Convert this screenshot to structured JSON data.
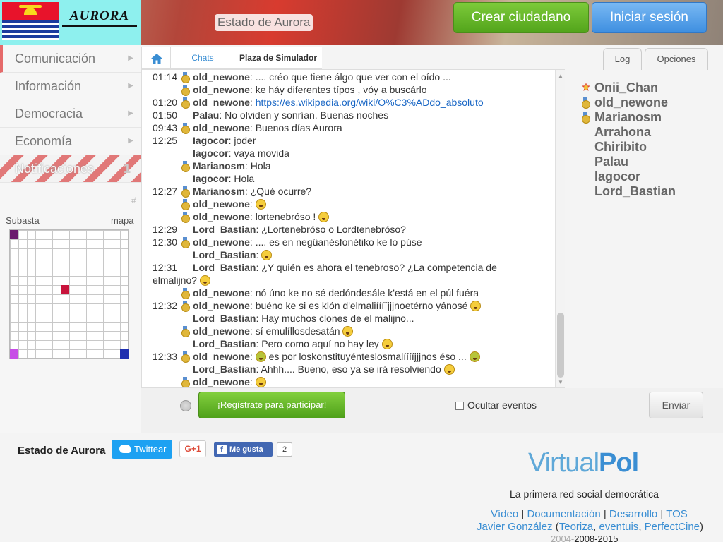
{
  "header": {
    "logo_text": "AURORA",
    "site_name": "Estado de Aurora",
    "create_citizen": "Crear ciudadano",
    "login": "Iniciar sesión"
  },
  "sidebar": {
    "items": [
      {
        "label": "Comunicación"
      },
      {
        "label": "Información"
      },
      {
        "label": "Democracia"
      },
      {
        "label": "Economía"
      },
      {
        "label": "Notificaciones",
        "count": "1"
      }
    ],
    "hash": "#",
    "auction": "Subasta",
    "map": "mapa"
  },
  "breadcrumb": {
    "chats": "Chats",
    "current": "Plaza de Simulador"
  },
  "tabs": {
    "log": "Log",
    "options": "Opciones"
  },
  "chat": {
    "messages": [
      {
        "time": "01:14",
        "nick": "old_newone",
        "text": ".... créo que tiene álgo que ver con el oído ...",
        "medal": true
      },
      {
        "time": "",
        "nick": "old_newone",
        "text": "ke háy diferentes típos , vóy a buscárlo",
        "medal": true
      },
      {
        "time": "01:20",
        "nick": "old_newone",
        "link": "https://es.wikipedia.org/wiki/O%C3%ADdo_absoluto",
        "medal": true
      },
      {
        "time": "01:50",
        "nick": "Palau",
        "text": "No olviden y sonrían. Buenas noches",
        "medal": false
      },
      {
        "time": "09:43",
        "nick": "old_newone",
        "text": "Buenos días Aurora",
        "medal": true
      },
      {
        "time": "12:25",
        "nick": "Iagocor",
        "text": "joder",
        "medal": false
      },
      {
        "time": "",
        "nick": "Iagocor",
        "text": "vaya movida",
        "medal": false
      },
      {
        "time": "",
        "nick": "Marianosm",
        "text": "Hola",
        "medal": true
      },
      {
        "time": "",
        "nick": "Iagocor",
        "text": "Hola",
        "medal": false
      },
      {
        "time": "12:27",
        "nick": "Marianosm",
        "text": "¿Qué ocurre?",
        "medal": true
      },
      {
        "time": "",
        "nick": "old_newone",
        "text": "",
        "medal": true,
        "emoji": true
      },
      {
        "time": "",
        "nick": "old_newone",
        "text": "lortenebróso !",
        "medal": true,
        "emoji": true
      },
      {
        "time": "12:29",
        "nick": "Lord_Bastian",
        "text": "¿Lortenebróso o Lordtenebróso?",
        "medal": false
      },
      {
        "time": "12:30",
        "nick": "old_newone",
        "text": ".... es en negüanésfonétiko ke lo púse",
        "medal": true
      },
      {
        "time": "",
        "nick": "Lord_Bastian",
        "text": "",
        "medal": false,
        "emoji": true
      },
      {
        "time": "12:31",
        "nick": "Lord_Bastian",
        "text": "¿Y quién es ahora el tenebroso? ¿La competencia de",
        "medal": false
      },
      {
        "time": "",
        "nick": "",
        "text": "elmalijno?",
        "medal": false,
        "emoji": true,
        "continuation": true
      },
      {
        "time": "",
        "nick": "old_newone",
        "text": "nó úno ke no sé dedóndesále k'está en el púl fuéra",
        "medal": true
      },
      {
        "time": "12:32",
        "nick": "old_newone",
        "text": "buéno ke si es klón d'elmaliííí¨jjjnoetérno yánosé",
        "medal": true,
        "emoji": true
      },
      {
        "time": "",
        "nick": "Lord_Bastian",
        "text": "Hay muchos clones de el malijno...",
        "medal": false
      },
      {
        "time": "",
        "nick": "old_newone",
        "text": "sí emulíllosdesatán",
        "medal": true,
        "emoji": true
      },
      {
        "time": "",
        "nick": "Lord_Bastian",
        "text": "Pero como aquí no hay ley",
        "medal": false,
        "emoji": true
      },
      {
        "time": "12:33",
        "nick": "old_newone",
        "text": "es por loskonstituyénteslosmalííííjjjnos éso ...",
        "medal": true,
        "emoji_pre": true,
        "emoji": true
      },
      {
        "time": "",
        "nick": "Lord_Bastian",
        "text": "Ahhh.... Bueno, eso ya se irá resolviendo",
        "medal": false,
        "emoji": true
      },
      {
        "time": "",
        "nick": "old_newone",
        "text": "",
        "medal": true,
        "emoji": true
      }
    ]
  },
  "chat_footer": {
    "register": "¡Regístrate para participar!",
    "hide_events": "Ocultar eventos",
    "send": "Enviar"
  },
  "users": [
    {
      "name": "Onii_Chan",
      "icon": "star"
    },
    {
      "name": "old_newone",
      "icon": "medal"
    },
    {
      "name": "Marianosm",
      "icon": "medal"
    },
    {
      "name": "Arrahona",
      "icon": ""
    },
    {
      "name": "Chiribito",
      "icon": ""
    },
    {
      "name": "Palau",
      "icon": ""
    },
    {
      "name": "Iagocor",
      "icon": ""
    },
    {
      "name": "Lord_Bastian",
      "icon": ""
    }
  ],
  "footer": {
    "title": "Estado de Aurora",
    "twitter": "Twittear",
    "gplus": "G+1",
    "fb_like": "Me gusta",
    "fb_count": "2",
    "vp_virtual": "Virtual",
    "vp_pol": "Pol",
    "tagline": "La primera red social democrática",
    "links1": [
      "Vídeo",
      "Documentación",
      "Desarrollo",
      "TOS"
    ],
    "author": "Javier González",
    "links2": [
      "Teoriza",
      "eventuis",
      "PerfectCine"
    ],
    "year_old": "2004-",
    "years": "2008-2015"
  },
  "colors": {
    "create_btn": "#5cb21e",
    "login_btn": "#4a97e6",
    "register_btn": "#5bb023",
    "link": "#3a8ed3",
    "map_cells": [
      "#6b1a6e",
      "#c8143c",
      "#c74ee6",
      "#1f2fb0"
    ]
  }
}
